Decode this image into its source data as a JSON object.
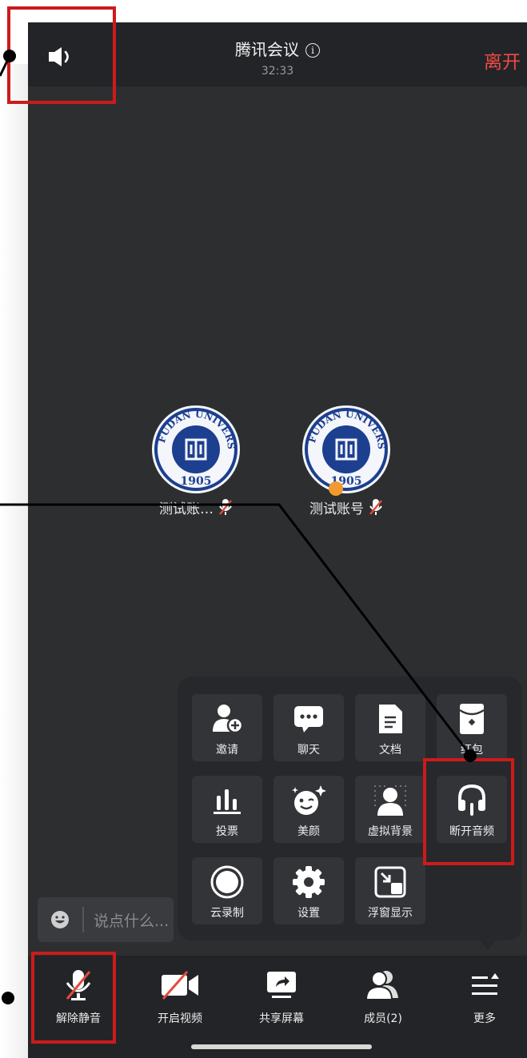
{
  "header": {
    "title": "腾讯会议",
    "info_glyph": "i",
    "timer": "32:33",
    "leave_label": "离开",
    "leave_color": "#f04a45"
  },
  "participants": [
    {
      "name": "测试账…",
      "logo_text": "FUDAN UNIVERSITY",
      "logo_year": "1905",
      "mic": "muted"
    },
    {
      "name": "测试账号",
      "logo_text": "FUDAN UNIVERSITY",
      "logo_year": "1905",
      "mic": "muted",
      "host": true
    }
  ],
  "more_panel": {
    "tiles": [
      {
        "label": "邀请",
        "icon": "invite-icon"
      },
      {
        "label": "聊天",
        "icon": "chat-icon"
      },
      {
        "label": "文档",
        "icon": "document-icon"
      },
      {
        "label": "红包",
        "icon": "red-packet-icon"
      },
      {
        "label": "投票",
        "icon": "vote-icon"
      },
      {
        "label": "美颜",
        "icon": "beauty-icon"
      },
      {
        "label": "虚拟背景",
        "icon": "virtual-background-icon"
      },
      {
        "label": "断开音频",
        "icon": "headphones-icon"
      },
      {
        "label": "云录制",
        "icon": "record-icon"
      },
      {
        "label": "设置",
        "icon": "gear-icon"
      },
      {
        "label": "浮窗显示",
        "icon": "float-window-icon"
      }
    ]
  },
  "chat": {
    "placeholder": "说点什么..."
  },
  "toolbar": {
    "items": [
      {
        "label": "解除静音",
        "icon": "mic-muted-icon"
      },
      {
        "label": "开启视频",
        "icon": "video-off-icon"
      },
      {
        "label": "共享屏幕",
        "icon": "share-screen-icon"
      },
      {
        "label": "成员(2)",
        "icon": "members-icon"
      },
      {
        "label": "更多",
        "icon": "more-icon"
      }
    ]
  },
  "annotation_color": "#cc1b1b"
}
